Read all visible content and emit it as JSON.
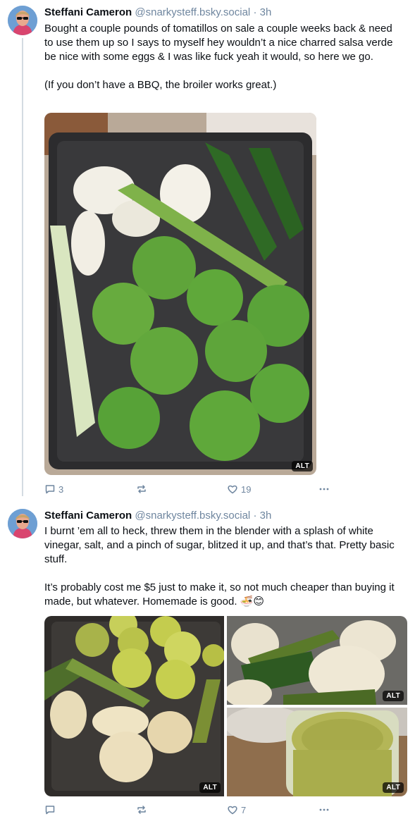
{
  "posts": [
    {
      "author": "Steffani Cameron",
      "handle": "@snarkysteff.bsky.social",
      "time": "· 3h",
      "paragraphs": [
        "Bought a couple pounds of tomatillos on sale a couple weeks back & need to use them up so I says to myself hey wouldn’t a nice charred salsa verde be nice with some eggs & I was like fuck yeah it would, so here we go.",
        "(If you don’t have a BBQ, the broiler works great.)"
      ],
      "image_alt_badge": "ALT",
      "reply_count": "3",
      "repost_count": "",
      "like_count": "19"
    },
    {
      "author": "Steffani Cameron",
      "handle": "@snarkysteff.bsky.social",
      "time": "· 3h",
      "paragraphs": [
        "I burnt ’em all to heck, threw them in the blender with a splash of white vinegar, salt, and a pinch of sugar, blitzed it up, and that’s that. Pretty basic stuff.",
        "It’s probably cost me $5 just to make it, so not much cheaper than buying it made, but whatever. Homemade is good. 🍜😊"
      ],
      "image_alt_badges": [
        "ALT",
        "ALT",
        "ALT"
      ],
      "reply_count": "",
      "repost_count": "",
      "like_count": "7"
    }
  ],
  "icons": {
    "reply": "speech-bubble-icon",
    "repost": "repost-arrows-icon",
    "like": "heart-icon",
    "more": "ellipsis-icon"
  },
  "colors": {
    "meta": "#6f869f",
    "text": "#0b0f14",
    "thread_line": "#d4dbe2"
  }
}
